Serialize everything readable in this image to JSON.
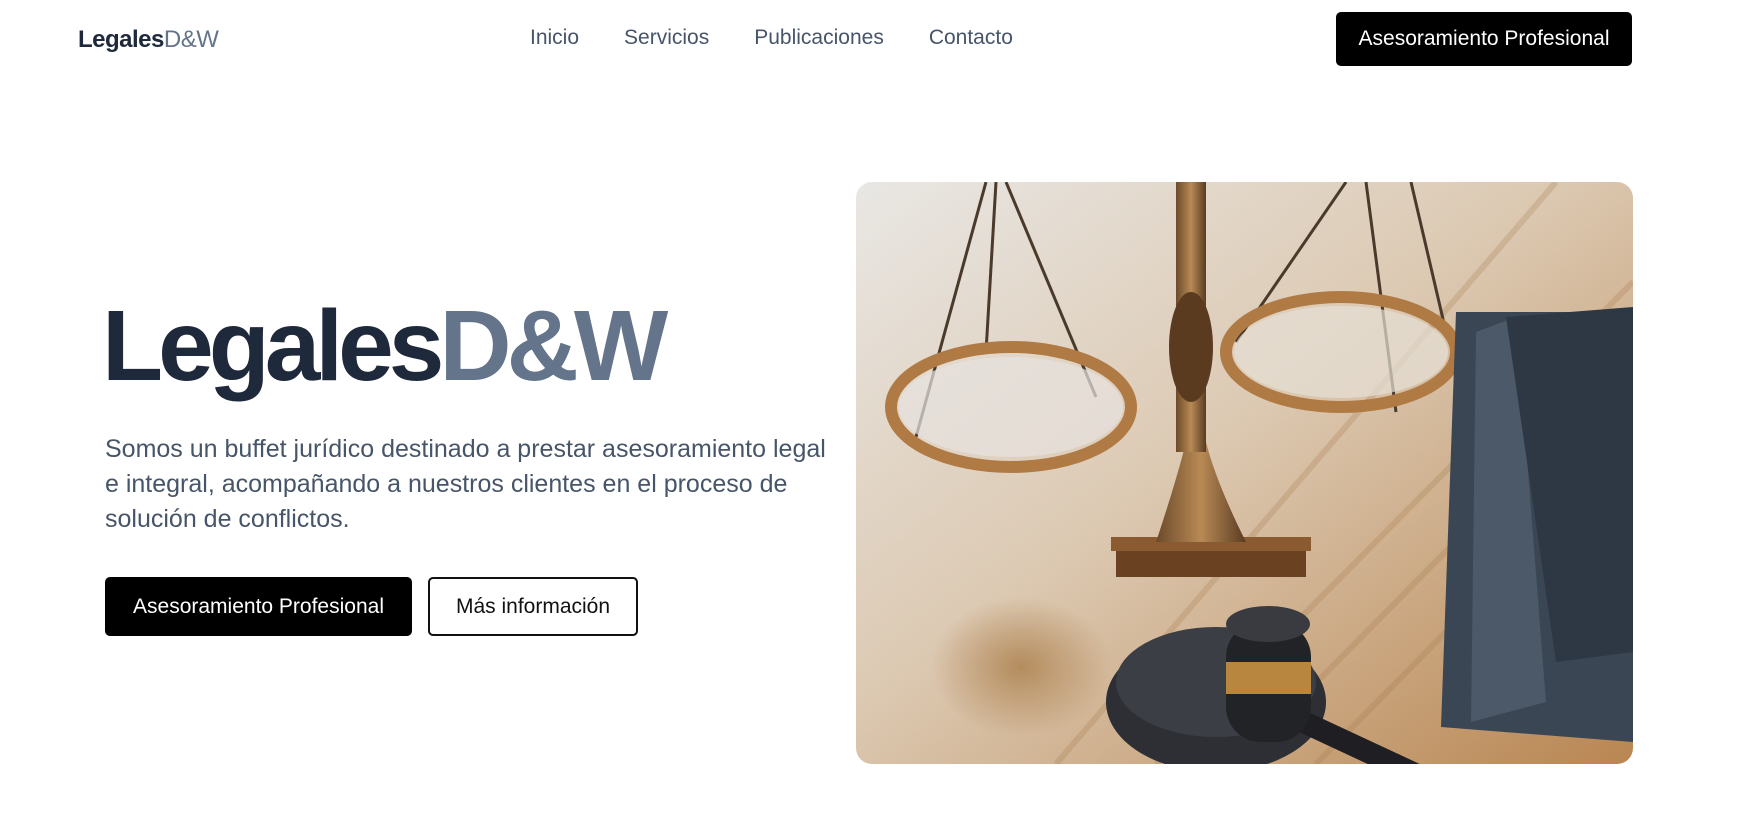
{
  "nav": {
    "brand_main": "Legales",
    "brand_accent": "D&W",
    "links": [
      "Inicio",
      "Servicios",
      "Publicaciones",
      "Contacto"
    ],
    "cta_label": "Asesoramiento Profesional"
  },
  "hero": {
    "title_main": "Legales",
    "title_accent": "D&W",
    "description": "Somos un buffet jurídico destinado a prestar asesoramiento legal e integral, acompañando a nuestros clientes en el proceso de solución de conflictos.",
    "primary_button": "Asesoramiento Profesional",
    "secondary_button": "Más información"
  },
  "colors": {
    "dark_text": "#1e293b",
    "accent_text": "#64748b",
    "button_bg": "#000000"
  }
}
